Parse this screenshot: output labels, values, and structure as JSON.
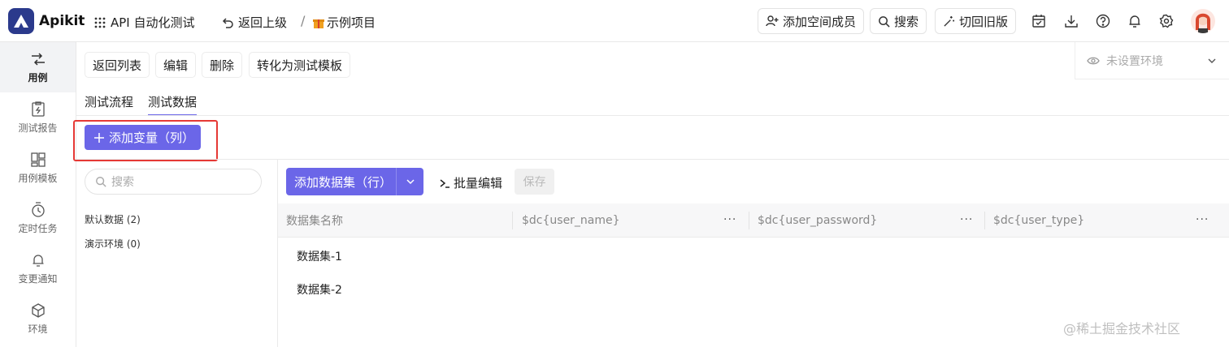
{
  "topbar": {
    "brand": "Apikit",
    "project": "API 自动化测试",
    "back_up": "返回上级",
    "slash": "/",
    "crumb": "示例项目",
    "add_member": "添加空间成员",
    "search": "搜索",
    "old_version": "切回旧版"
  },
  "sidebar": {
    "items": [
      {
        "label": "用例",
        "icon": "case-icon"
      },
      {
        "label": "测试报告",
        "icon": "report-icon"
      },
      {
        "label": "用例模板",
        "icon": "template-icon"
      },
      {
        "label": "定时任务",
        "icon": "timer-icon"
      },
      {
        "label": "变更通知",
        "icon": "bell-icon"
      },
      {
        "label": "环境",
        "icon": "cube-icon"
      }
    ]
  },
  "toolbar": {
    "back_list": "返回列表",
    "edit": "编辑",
    "delete": "删除",
    "to_template": "转化为测试模板"
  },
  "env_select": {
    "placeholder": "未设置环境"
  },
  "tabs": [
    {
      "label": "测试流程",
      "active": false
    },
    {
      "label": "测试数据",
      "active": true
    }
  ],
  "add_variable": "添加变量（列）",
  "left_panel": {
    "search_placeholder": "搜索",
    "items": [
      "默认数据 (2)",
      "演示环境 (0)"
    ]
  },
  "data_toolbar": {
    "add_dataset": "添加数据集（行）",
    "batch_edit": "批量编辑",
    "save": "保存"
  },
  "table": {
    "columns": [
      "数据集名称",
      "$dc{user_name}",
      "$dc{user_password}",
      "$dc{user_type}"
    ],
    "more": "···",
    "rows": [
      "数据集-1",
      "数据集-2"
    ]
  },
  "watermark": "@稀土掘金技术社区",
  "colors": {
    "accent": "#6b66e8",
    "highlight": "#e53935",
    "logo": "#2b3a8c"
  }
}
